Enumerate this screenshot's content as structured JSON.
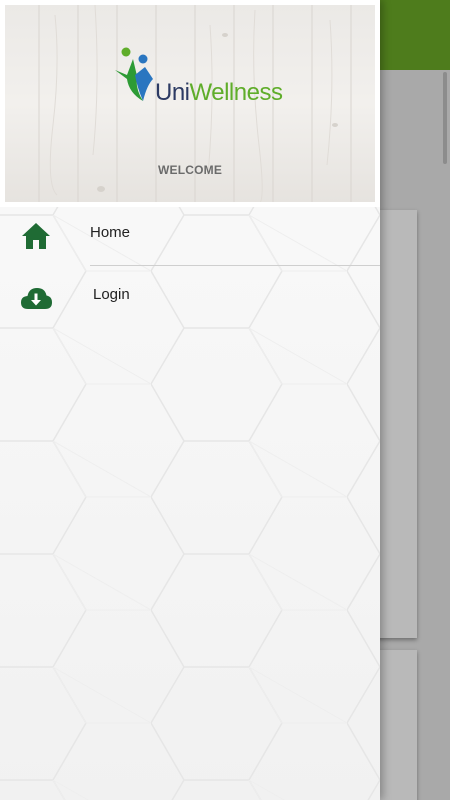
{
  "header": {
    "brand": {
      "uni": "Uni",
      "wellness": "Wellness"
    },
    "welcome": "WELCOME"
  },
  "menu": {
    "items": [
      {
        "label": "Home",
        "icon": "home-icon"
      },
      {
        "label": "Login",
        "icon": "cloud-download-icon"
      }
    ]
  },
  "colors": {
    "toolbar": "#4e7c1c",
    "icon_green": "#1f6b34",
    "brand_green": "#5fad2a",
    "brand_blue": "#2c3a63"
  }
}
